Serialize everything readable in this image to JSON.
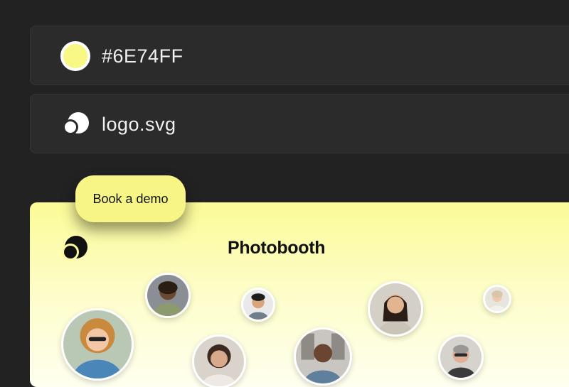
{
  "settings": {
    "brand_color": {
      "value": "#6E74FF",
      "swatch_color": "#F8F884"
    },
    "logo": {
      "filename": "logo.svg",
      "icon": "logo-icon"
    }
  },
  "cta": {
    "label": "Book a demo"
  },
  "preview": {
    "title": "Photobooth",
    "logo_icon": "logo-icon",
    "background_color": "#FBFB96",
    "participants": [
      {
        "name": "participant-avatar"
      },
      {
        "name": "participant-avatar"
      },
      {
        "name": "participant-avatar"
      },
      {
        "name": "participant-avatar"
      },
      {
        "name": "participant-avatar"
      },
      {
        "name": "participant-avatar"
      },
      {
        "name": "participant-avatar"
      },
      {
        "name": "participant-avatar"
      },
      {
        "name": "participant-avatar"
      }
    ]
  }
}
